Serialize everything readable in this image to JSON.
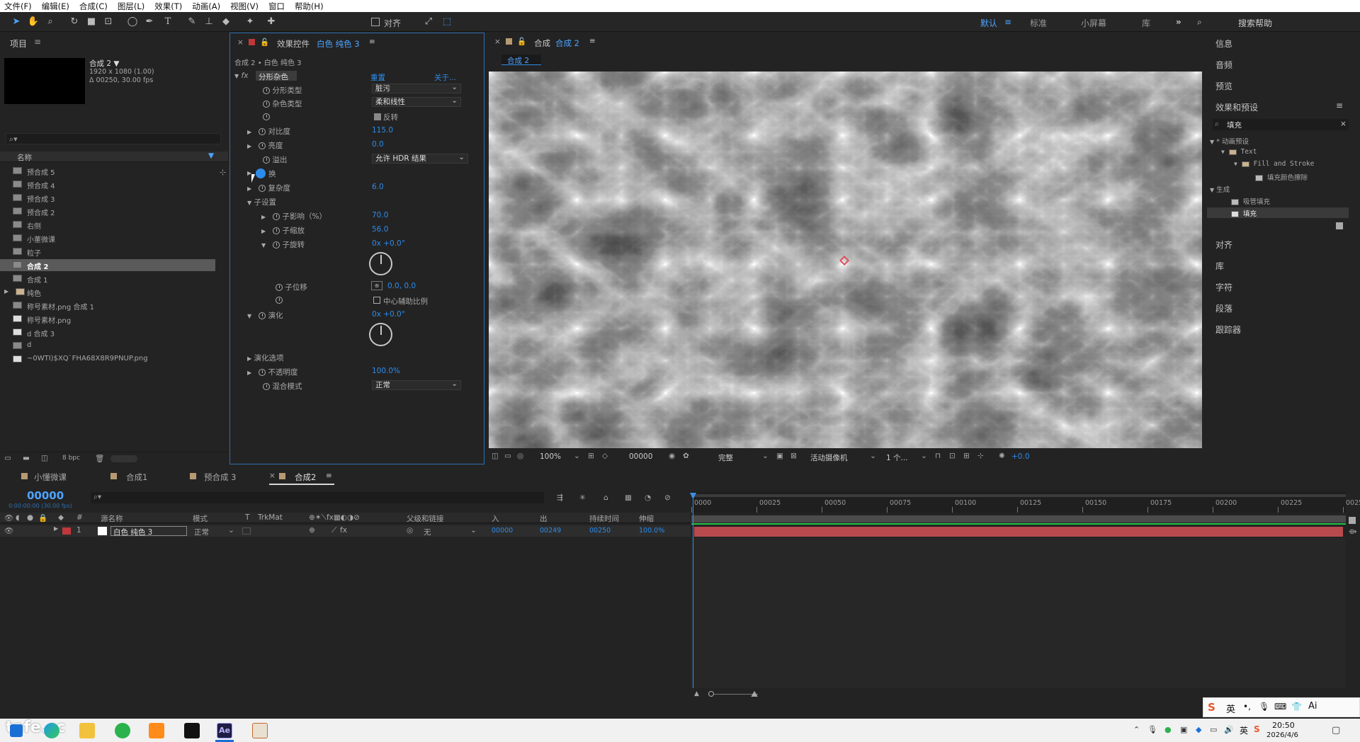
{
  "menu": [
    "文件(F)",
    "编辑(E)",
    "合成(C)",
    "图层(L)",
    "效果(T)",
    "动画(A)",
    "视图(V)",
    "窗口",
    "帮助(H)"
  ],
  "toolbar": {
    "align_label": "对齐",
    "workspaces": [
      "默认",
      "标准",
      "小屏幕",
      "库"
    ],
    "search_help": "搜索帮助"
  },
  "project": {
    "title": "项目",
    "comp_name": "合成 2 ▼",
    "comp_size": "1920 x 1080 (1.00)",
    "comp_dur": "Δ 00250, 30.00 fps",
    "col_name": "名称",
    "items": [
      {
        "name": "预合成 5",
        "type": "comp"
      },
      {
        "name": "预合成 4",
        "type": "comp"
      },
      {
        "name": "预合成 3",
        "type": "comp"
      },
      {
        "name": "预合成 2",
        "type": "comp"
      },
      {
        "name": "右侧",
        "type": "comp"
      },
      {
        "name": "小董微课",
        "type": "comp"
      },
      {
        "name": "粒子",
        "type": "comp"
      },
      {
        "name": "合成 2",
        "type": "comp",
        "selected": true
      },
      {
        "name": "合成 1",
        "type": "comp"
      },
      {
        "name": "纯色",
        "type": "folder"
      },
      {
        "name": "称号素材.png 合成 1",
        "type": "comp"
      },
      {
        "name": "称号素材.png",
        "type": "img"
      },
      {
        "name": "d 合成 3",
        "type": "img"
      },
      {
        "name": "d",
        "type": "comp"
      },
      {
        "name": "~0WTI)$XQ`FHA68X8R9PNUP.png",
        "type": "img"
      }
    ],
    "bpc": "8 bpc"
  },
  "effects": {
    "tab_prefix": "效果控件",
    "tab_layer": "白色 纯色 3",
    "breadcrumb": "合成 2 • 白色 纯色 3",
    "effect_name": "分形杂色",
    "reset": "重置",
    "about": "关于...",
    "props": {
      "fractal_type": {
        "label": "分形类型",
        "value": "脏污"
      },
      "noise_type": {
        "label": "杂色类型",
        "value": "柔和线性"
      },
      "invert": {
        "label": "反转"
      },
      "contrast": {
        "label": "对比度",
        "value": "115.0"
      },
      "brightness": {
        "label": "亮度",
        "value": "0.0"
      },
      "overflow": {
        "label": "溢出",
        "value": "允许 HDR 结果"
      },
      "transform": {
        "label": "换"
      },
      "complexity": {
        "label": "复杂度",
        "value": "6.0"
      },
      "sub_settings": {
        "label": "子设置"
      },
      "sub_influence": {
        "label": "子影响（%）",
        "value": "70.0"
      },
      "sub_scale": {
        "label": "子缩放",
        "value": "56.0"
      },
      "sub_rotation": {
        "label": "子旋转",
        "value": "0x +0.0°"
      },
      "sub_offset": {
        "label": "子位移",
        "value": "0.0, 0.0"
      },
      "center_scale": {
        "label": "中心辅助比例"
      },
      "evolution": {
        "label": "演化",
        "value": "0x +0.0°"
      },
      "evolution_options": {
        "label": "演化选项"
      },
      "opacity": {
        "label": "不透明度",
        "value": "100.0%"
      },
      "blend_mode": {
        "label": "混合模式",
        "value": "正常"
      }
    }
  },
  "composition": {
    "tab_prefix": "合成",
    "tab_name": "合成 2",
    "sub_tab": "合成 2",
    "zoom": "100%",
    "timecode": "00000",
    "resolution": "完整",
    "camera": "活动摄像机",
    "views": "1 个...",
    "exposure": "+0.0"
  },
  "right_panels": {
    "info": "信息",
    "audio": "音频",
    "preview": "预览",
    "effects_presets": "效果和预设",
    "search_value": "填充",
    "tree": {
      "anim_presets": "* 动画预设",
      "text": "Text",
      "fill_stroke": "Fill and Stroke",
      "fill_color_wipe": "填充颜色擦除",
      "generate": "生成",
      "tube_fill": "吸管填充",
      "fill": "填充"
    },
    "align": "对齐",
    "library": "库",
    "character": "字符",
    "paragraph": "段落",
    "tracker": "跟踪器"
  },
  "timeline": {
    "tabs": [
      "小懂微课",
      "合成1",
      "预合成 3",
      "合成2"
    ],
    "active_tab": "合成2",
    "timecode": "00000",
    "timecode_sub": "0:00:00:00 (30.00 fps)",
    "col_source": "源名称",
    "col_mode": "模式",
    "col_t": "T",
    "col_trkmat": "TrkMat",
    "col_parent": "父级和链接",
    "col_in": "入",
    "col_out": "出",
    "col_duration": "持续时间",
    "col_stretch": "伸缩",
    "layer": {
      "index": "1",
      "name": "白色 纯色 3",
      "mode": "正常",
      "parent": "无",
      "in": "00000",
      "out": "00249",
      "duration": "00250",
      "stretch": "100.0%"
    },
    "ruler": [
      "0000",
      "00025",
      "00050",
      "00075",
      "00100",
      "00125",
      "00150",
      "00175",
      "00200",
      "00225",
      "0025"
    ]
  },
  "taskbar": {
    "ime": "英",
    "time": "20:50",
    "date": "2026/4/6",
    "watermark": "tafe.cc"
  },
  "colors": {
    "accent": "#2d8ceb",
    "layer_bar": "#b84a4e",
    "label_red": "#c0383b"
  }
}
